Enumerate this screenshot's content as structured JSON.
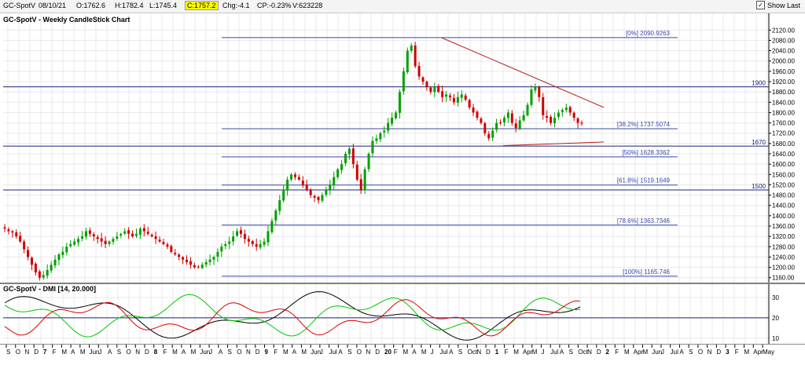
{
  "toolbar": {
    "symbol": "GC-SpotV",
    "date": "08/10/21",
    "open": "O:1762.6",
    "high": "H:1782.4",
    "low": "L:1745.4",
    "close": "C:1757.2",
    "chg": "Chg:-4.1",
    "cp": "CP:-0.23%",
    "volume": "V:623228",
    "show_last_label": "Show Last",
    "show_last_checked": "✓"
  },
  "chart_data": [
    {
      "type": "candlestick",
      "title": "GC-SpotV - Weekly CandleStick Chart",
      "ylim": [
        1150,
        2130
      ],
      "y_ticks": [
        "2120.00",
        "2080.00",
        "2040.00",
        "2000.00",
        "1960.00",
        "1920.00",
        "1880.00",
        "1840.00",
        "1800.00",
        "1760.00",
        "1720.00",
        "1680.00",
        "1640.00",
        "1600.00",
        "1560.00",
        "1520.00",
        "1480.00",
        "1440.00",
        "1400.00",
        "1360.00",
        "1320.00",
        "1280.00",
        "1240.00",
        "1200.00",
        "1160.00"
      ],
      "horizontal_levels": [
        {
          "label": "1900",
          "value": 1900
        },
        {
          "label": "1670",
          "value": 1670
        },
        {
          "label": "1500",
          "value": 1500
        }
      ],
      "fib_levels": [
        {
          "label": "[0%] 2090.9263",
          "value": 2090.9263
        },
        {
          "label": "[38.2%] 1737.5074",
          "value": 1737.5074
        },
        {
          "label": "[50%] 1628.3362",
          "value": 1628.3362
        },
        {
          "label": "[61.8%] 1519.1649",
          "value": 1519.1649
        },
        {
          "label": "[78.6%] 1363.7346",
          "value": 1363.7346
        },
        {
          "label": "[100%] 1165.746",
          "value": 1165.746
        }
      ],
      "trendlines": [
        {
          "name": "resistance",
          "from": [
            "Aug 2020",
            2090
          ],
          "to": [
            "Oct 2021",
            1820
          ]
        },
        {
          "name": "support",
          "from": [
            "Mar 2021",
            1672
          ],
          "to": [
            "Oct 2021",
            1686
          ]
        }
      ],
      "close_path": [
        1350,
        1340,
        1335,
        1320,
        1300,
        1270,
        1240,
        1210,
        1180,
        1160,
        1170,
        1190,
        1210,
        1230,
        1250,
        1260,
        1280,
        1290,
        1300,
        1310,
        1320,
        1340,
        1330,
        1320,
        1310,
        1300,
        1290,
        1300,
        1310,
        1320,
        1330,
        1340,
        1330,
        1320,
        1330,
        1350,
        1340,
        1330,
        1320,
        1310,
        1300,
        1290,
        1280,
        1260,
        1250,
        1240,
        1230,
        1220,
        1210,
        1200,
        1200,
        1210,
        1220,
        1230,
        1240,
        1260,
        1280,
        1290,
        1300,
        1320,
        1340,
        1330,
        1310,
        1300,
        1290,
        1280,
        1290,
        1300,
        1340,
        1380,
        1420,
        1460,
        1500,
        1540,
        1560,
        1550,
        1540,
        1520,
        1500,
        1480,
        1470,
        1460,
        1480,
        1500,
        1520,
        1550,
        1580,
        1600,
        1640,
        1660,
        1600,
        1540,
        1500,
        1580,
        1640,
        1690,
        1700,
        1720,
        1730,
        1760,
        1780,
        1800,
        1880,
        1960,
        2040,
        2060,
        1980,
        1940,
        1920,
        1900,
        1880,
        1900,
        1880,
        1860,
        1870,
        1860,
        1840,
        1860,
        1870,
        1850,
        1820,
        1800,
        1780,
        1760,
        1720,
        1700,
        1730,
        1760,
        1760,
        1780,
        1800,
        1760,
        1740,
        1770,
        1790,
        1830,
        1890,
        1900,
        1860,
        1790,
        1780,
        1760,
        1780,
        1800,
        1810,
        1820,
        1800,
        1780,
        1760,
        1757
      ]
    },
    {
      "type": "line",
      "title": "GC-SpotV - DMI [14, 20.000]",
      "ylim": [
        8,
        35
      ],
      "y_ticks": [
        "30",
        "20",
        "10"
      ],
      "reference_line": 20,
      "series": []
    }
  ],
  "x_axis_labels": [
    "S",
    "O",
    "N",
    "D",
    "7",
    "F",
    "M",
    "A",
    "M",
    "Jun",
    "J",
    "A",
    "S",
    "O",
    "N",
    "D",
    "8",
    "F",
    "M",
    "A",
    "M",
    "Jun",
    "J",
    "A",
    "S",
    "O",
    "N",
    "D",
    "9",
    "F",
    "M",
    "A",
    "M",
    "Jun",
    "J",
    "Jul",
    "A",
    "S",
    "O",
    "N",
    "D",
    "20",
    "F",
    "M",
    "A",
    "M",
    "J",
    "Jul",
    "A",
    "S",
    "Oct",
    "N",
    "D",
    "1",
    "F",
    "M",
    "Apr",
    "M",
    "J",
    "Jul",
    "A",
    "S",
    "Oct",
    "N",
    "D",
    "2",
    "F",
    "M",
    "Apr",
    "M",
    "Jun",
    "J",
    "Jul",
    "A",
    "S",
    "O",
    "N",
    "D",
    "3",
    "F",
    "M",
    "Apr",
    "May"
  ],
  "colors": {
    "up": "#00a000",
    "down": "#d00000",
    "level": "#1a237e",
    "fib": "#3949ab",
    "resistance": "#b71c1c",
    "adx": "#000000",
    "plus_di": "#00c800",
    "minus_di": "#e00000"
  }
}
